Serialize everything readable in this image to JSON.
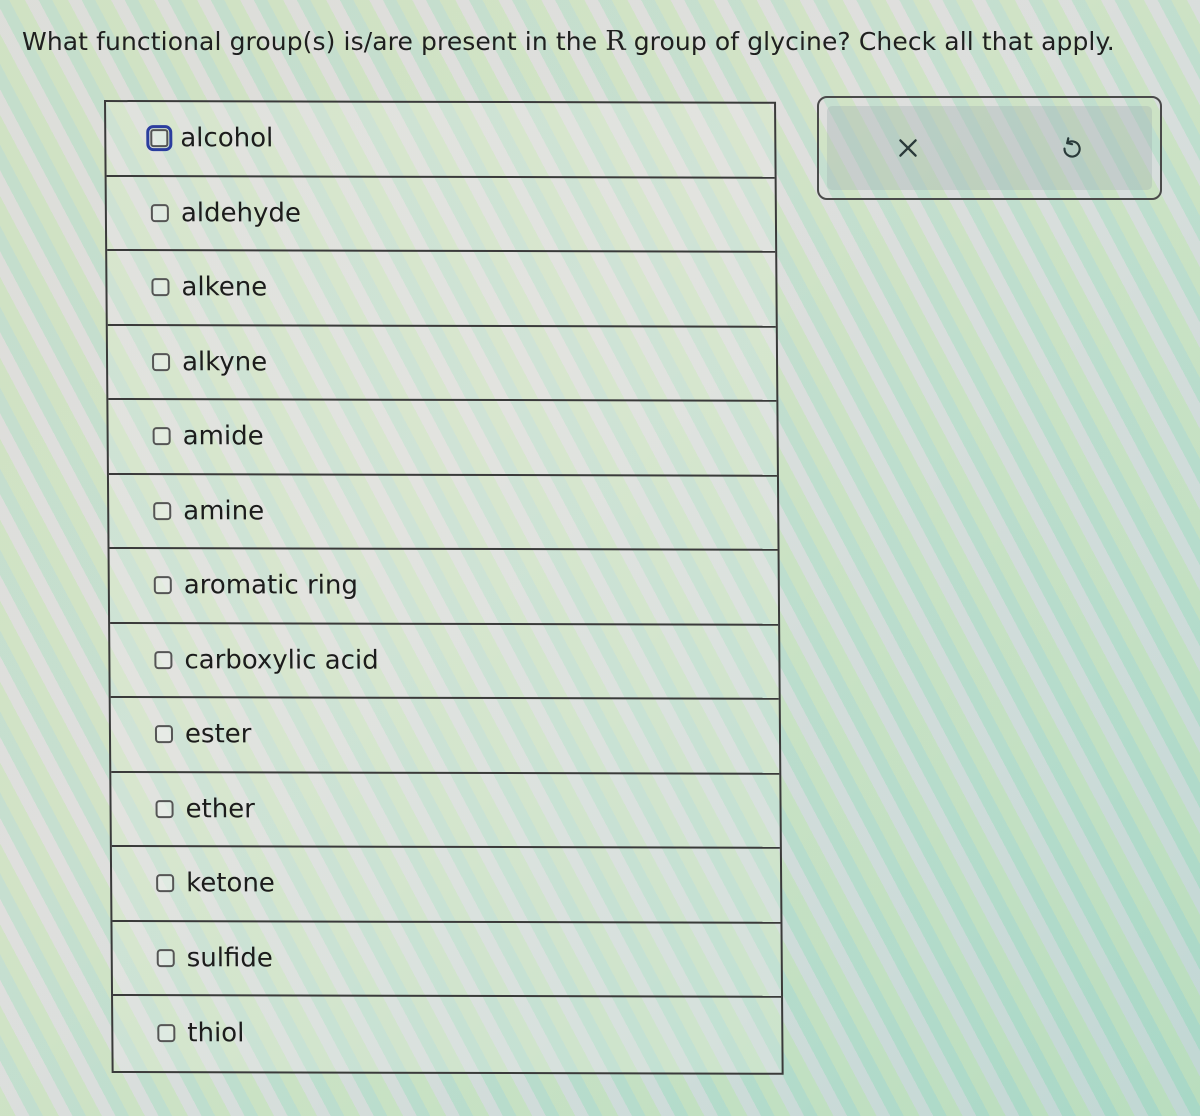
{
  "question": {
    "prefix": "What functional group(s) is/are present in the ",
    "r_symbol": "R",
    "suffix": " group of glycine? Check all that apply."
  },
  "options": [
    {
      "label": "alcohol",
      "checked": false,
      "focused": true
    },
    {
      "label": "aldehyde",
      "checked": false
    },
    {
      "label": "alkene",
      "checked": false
    },
    {
      "label": "alkyne",
      "checked": false
    },
    {
      "label": "amide",
      "checked": false
    },
    {
      "label": "amine",
      "checked": false
    },
    {
      "label": "aromatic ring",
      "checked": false
    },
    {
      "label": "carboxylic acid",
      "checked": false
    },
    {
      "label": "ester",
      "checked": false
    },
    {
      "label": "ether",
      "checked": false
    },
    {
      "label": "ketone",
      "checked": false
    },
    {
      "label": "sulfide",
      "checked": false
    },
    {
      "label": "thiol",
      "checked": false
    }
  ],
  "actions": {
    "clear_icon": "close-icon",
    "reset_icon": "undo-icon"
  },
  "colors": {
    "focus_ring": "#2b3d9e",
    "border": "#3a3a3a",
    "text": "#1f1f1f"
  }
}
